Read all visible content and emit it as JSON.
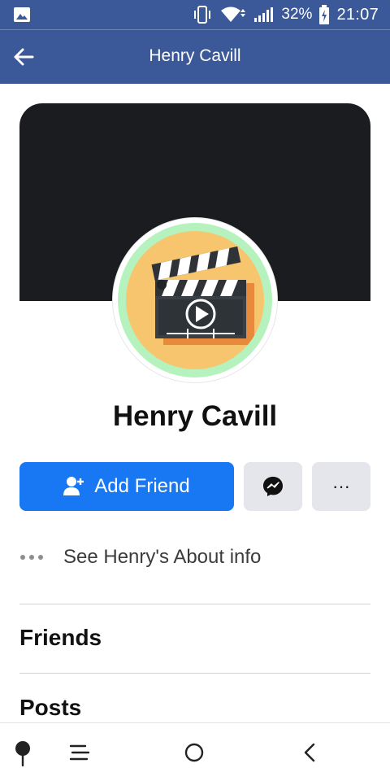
{
  "status_bar": {
    "battery": "32%",
    "time": "21:07",
    "icons": [
      "image-icon",
      "vibrate-icon",
      "wifi-icon",
      "signal-icon",
      "battery-charging-icon"
    ]
  },
  "app_bar": {
    "title": "Henry Cavill",
    "back_icon": "arrow-left-icon"
  },
  "profile": {
    "name": "Henry Cavill",
    "avatar_icon": "movie-clapperboard-icon"
  },
  "actions": {
    "add_friend_label": "Add Friend",
    "add_friend_icon": "add-user-icon",
    "messenger_icon": "messenger-icon",
    "more_label": "···"
  },
  "about": {
    "label": "See Henry's About info"
  },
  "sections": {
    "friends": "Friends",
    "posts": "Posts"
  },
  "nav": {
    "items": [
      "pin-icon",
      "menu-icon",
      "home-icon",
      "back-icon"
    ]
  },
  "colors": {
    "brand_bar": "#3b5998",
    "primary_button": "#1877f2",
    "secondary_button": "#e4e6eb"
  }
}
